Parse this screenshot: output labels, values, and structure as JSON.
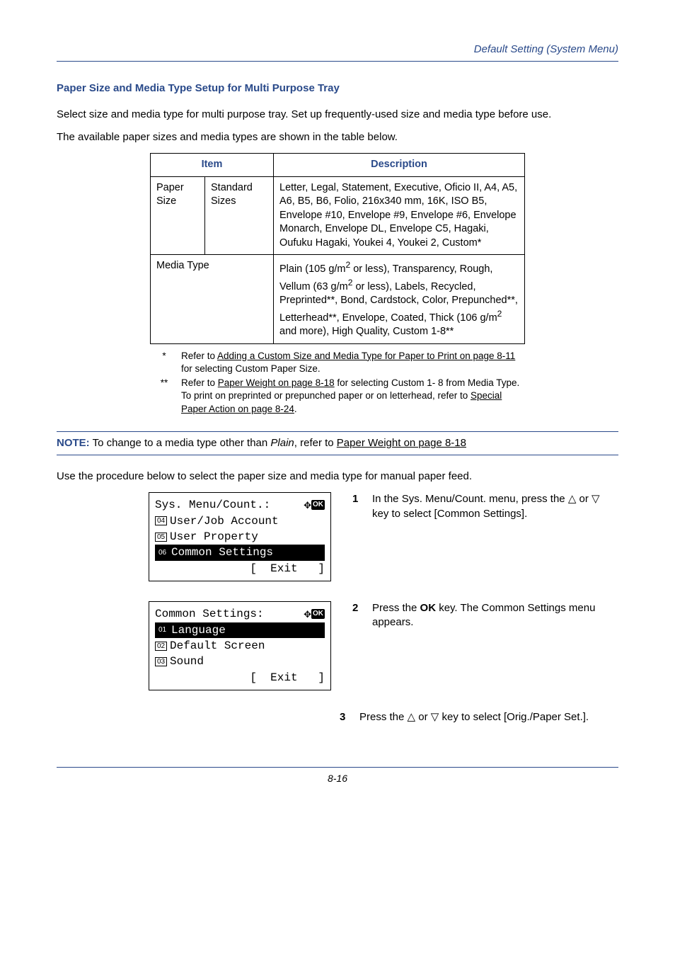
{
  "header": {
    "section": "Default Setting (System Menu)"
  },
  "title": "Paper Size and Media Type Setup for Multi Purpose Tray",
  "intro1": "Select size and media type for multi purpose tray. Set up frequently-used size and media type before use.",
  "intro2": "The available paper sizes and media types are shown in the table below.",
  "table": {
    "head_item": "Item",
    "head_desc": "Description",
    "row1_c1": "Paper Size",
    "row1_c2": "Standard Sizes",
    "row1_desc": "Letter, Legal, Statement, Executive, Oficio II, A4, A5, A6, B5, B6, Folio, 216x340 mm, 16K, ISO B5, Envelope #10, Envelope #9, Envelope #6, Envelope Monarch, Envelope DL, Envelope C5, Hagaki, Oufuku Hagaki, Youkei 4, Youkei 2, Custom*",
    "row2_c1": "Media Type",
    "row2_desc_a": "Plain (105 g/m",
    "row2_desc_b": " or less), Transparency, Rough, Vellum (63 g/m",
    "row2_desc_c": " or less), Labels, Recycled, Preprinted**, Bond, Cardstock, Color, Prepunched**, Letterhead**, Envelope, Coated, Thick (106 g/m",
    "row2_desc_d": " and more), High Quality, Custom 1-8**"
  },
  "footnotes": {
    "star": "*",
    "star_a": "Refer to ",
    "star_link": "Adding a Custom Size and Media Type for Paper to Print on page 8-11",
    "star_b": " for selecting Custom Paper Size.",
    "dstar": "**",
    "dstar_a": "Refer to ",
    "dstar_link": "Paper Weight on page 8-18",
    "dstar_b": " for selecting Custom 1- 8 from Media Type.",
    "dstar_c": "To print on preprinted or prepunched paper or on letterhead, refer to ",
    "dstar_link2": "Special Paper Action on page 8-24",
    "dstar_d": "."
  },
  "note": {
    "label": "NOTE:",
    "text_a": " To change to a media type other than ",
    "plain": "Plain",
    "text_b": ", refer to ",
    "link": "Paper Weight on page 8-18"
  },
  "procedure_intro": "Use the procedure below to select the paper size and media type for manual paper feed.",
  "lcd1": {
    "title": "Sys. Menu/Count.:",
    "n4": "4",
    "l4": "User/Job Account",
    "n5": "5",
    "l5": "User Property",
    "n6": "6",
    "l6": "Common Settings",
    "exit": "[  Exit   ]"
  },
  "lcd2": {
    "title": "Common Settings:",
    "n1": "1",
    "l1": "Language",
    "n2": "2",
    "l2": "Default Screen",
    "n3": "3",
    "l3": "Sound",
    "exit": "[  Exit   ]"
  },
  "steps": {
    "s1n": "1",
    "s1a": "In the Sys. Menu/Count. menu, press the ",
    "s1b": " or ",
    "s1c": " key to select [Common Settings].",
    "s2n": "2",
    "s2a": "Press the ",
    "s2ok": "OK",
    "s2b": " key. The Common Settings menu appears.",
    "s3n": "3",
    "s3a": "Press the ",
    "s3b": " or ",
    "s3c": " key to select [Orig./Paper Set.]."
  },
  "footer": "8-16"
}
